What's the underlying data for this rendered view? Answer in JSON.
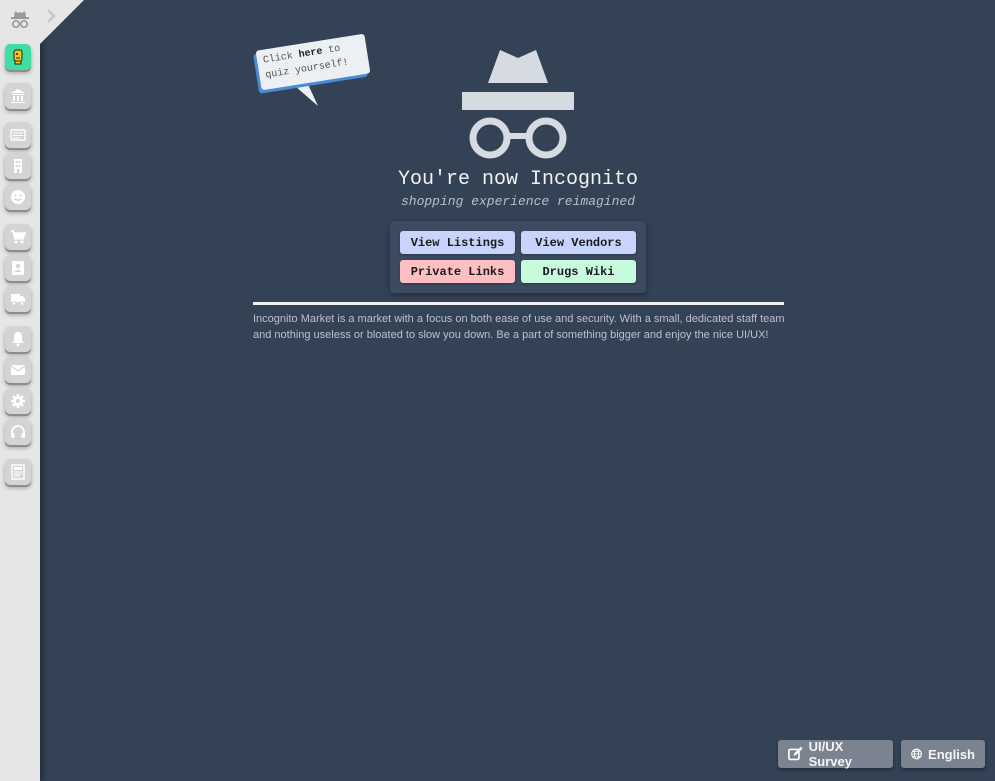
{
  "hero": {
    "title": "You're now Incognito",
    "subtitle": "shopping experience reimagined"
  },
  "buttons": {
    "view_listings": "View Listings",
    "view_vendors": "View Vendors",
    "private_links": "Private Links",
    "drugs_wiki": "Drugs Wiki"
  },
  "description": "Incognito Market is a market with a focus on both ease of use and security. With a small, dedicated staff team and nothing useless or bloated to slow you down. Be a part of something bigger and enjoy the nice UI/UX!",
  "bubble": {
    "line1_a": "Click ",
    "line1_bold": "here",
    "line1_b": " to",
    "line2": "quiz yourself!"
  },
  "footer": {
    "survey_label": "UI/UX Survey",
    "language_label": "English"
  },
  "sidebar": {
    "icons": [
      "avatar",
      "bank-icon",
      "listings-icon",
      "building-icon",
      "smiley-icon",
      "cart-icon",
      "contacts-icon",
      "truck-icon",
      "bell-icon",
      "envelope-icon",
      "gear-icon",
      "headset-icon",
      "document-icon"
    ]
  },
  "colors": {
    "background": "#344256",
    "sidebar": "#e6e6e6",
    "avatar_bg": "#3ee0a1",
    "button_blue": "#c7d4fb",
    "button_red": "#fdbfc4",
    "button_green": "#c8fbdd"
  }
}
